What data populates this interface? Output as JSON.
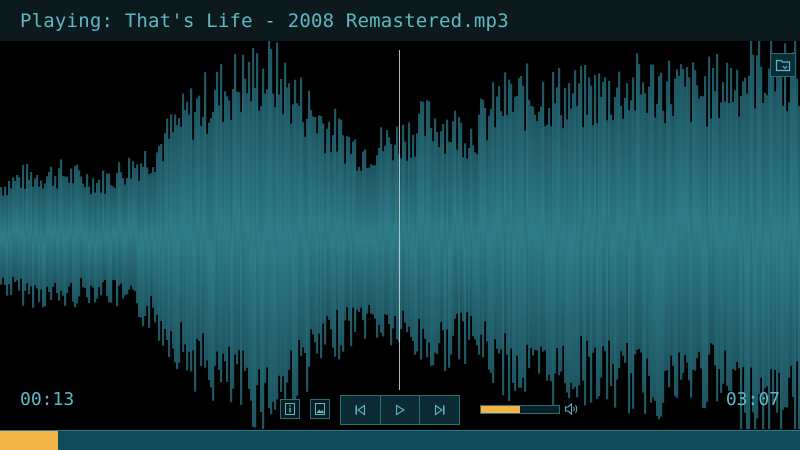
{
  "player": {
    "title": "Playing: That's Life - 2008 Remastered.mp3",
    "elapsed": "00:13",
    "total": "03:07",
    "progress_fraction": 0.072,
    "volume_fraction": 0.5
  },
  "icons": {
    "corner": "folder-icon",
    "info": "info-icon",
    "image": "image-icon",
    "previous": "previous-track-icon",
    "play": "play-icon",
    "next": "next-track-icon",
    "volume": "volume-icon"
  },
  "colors": {
    "accent": "#5fb8c6",
    "waveform": "#2a7480",
    "progress": "#f3b447",
    "track": "#0f4a58",
    "background": "#000000"
  }
}
